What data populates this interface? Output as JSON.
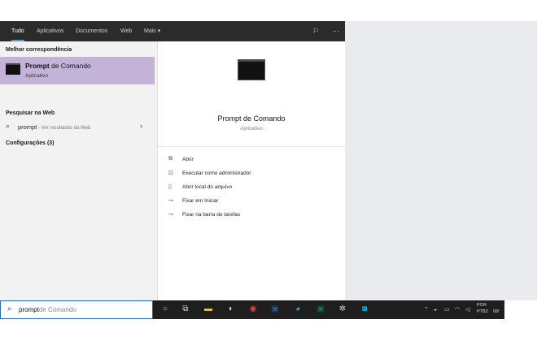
{
  "tabs": [
    {
      "label": "Tudo"
    },
    {
      "label": "Aplicativos"
    },
    {
      "label": "Documentos"
    },
    {
      "label": "Web"
    },
    {
      "label": "Mais ▾"
    }
  ],
  "icons": {
    "feedback": "feedback-icon",
    "more": "more-options-icon",
    "search": "search-icon",
    "chevron": "chevron-right-icon"
  },
  "left": {
    "best_match_header": "Melhor correspondência",
    "best_match": {
      "title_bold": "Prompt",
      "title_rest": " de Comando",
      "subtitle": "Aplicativo"
    },
    "web_header": "Pesquisar na Web",
    "web_result": {
      "query": "prompt",
      "hint": " - Ver resultados da Web"
    },
    "settings_header": "Configurações (3)"
  },
  "right": {
    "title": "Prompt de Comando",
    "subtitle": "Aplicativo",
    "actions": [
      {
        "label": "Abrir",
        "icon": "open-icon"
      },
      {
        "label": "Executar como administrador",
        "icon": "run-as-admin-icon"
      },
      {
        "label": "Abrir local do arquivo",
        "icon": "file-location-icon"
      },
      {
        "label": "Fixar em Iniciar",
        "icon": "pin-start-icon"
      },
      {
        "label": "Fixar na barra de tarefas",
        "icon": "pin-taskbar-icon"
      }
    ]
  },
  "taskbar": {
    "search_typed": "prompt",
    "search_ghost": "de Comando",
    "lang_line1": "POR",
    "lang_line2": "PTB2",
    "time_partial": "08/"
  },
  "colors": {
    "highlight": "#c3b3d9",
    "topbar": "#2b2b2b",
    "taskbar": "#1e1e1e",
    "accent": "#5b9bd5"
  }
}
